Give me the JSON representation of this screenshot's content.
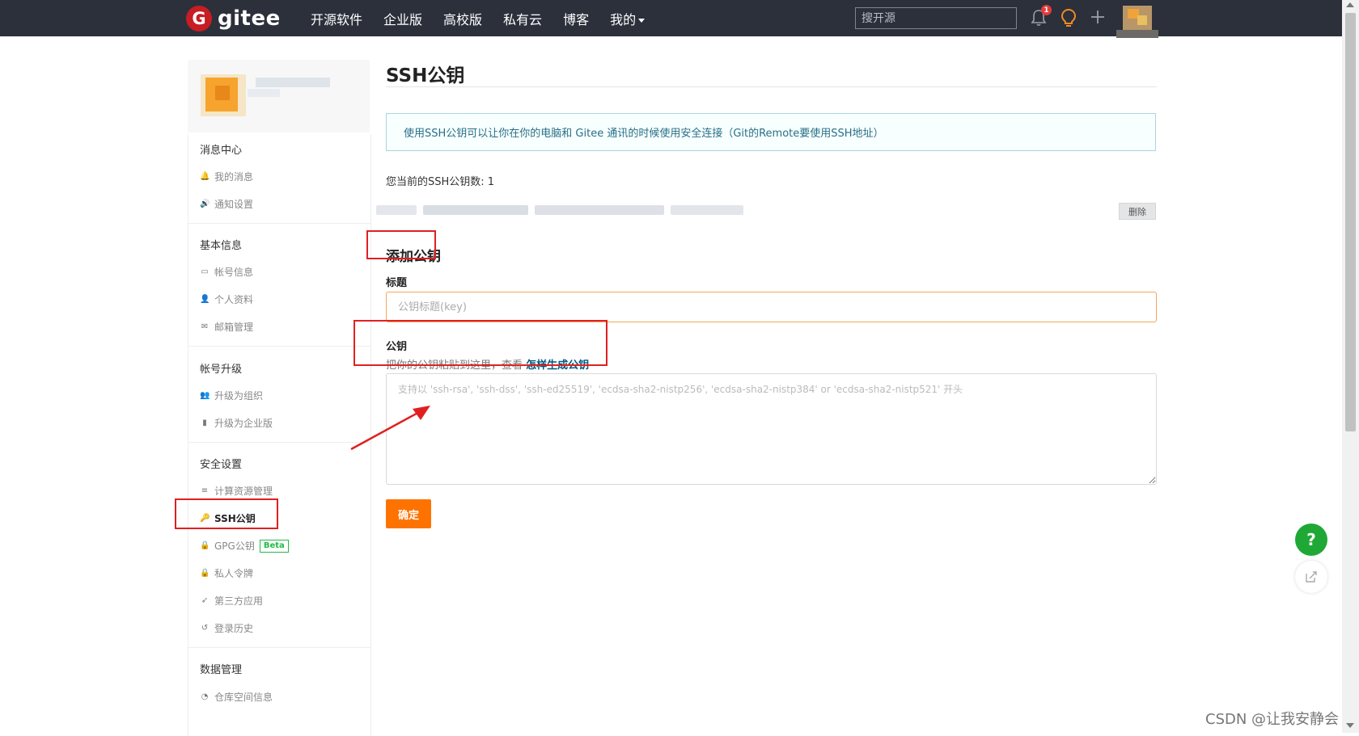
{
  "nav": {
    "logo_mark": "G",
    "logo_text": "gitee",
    "items": [
      "开源软件",
      "企业版",
      "高校版",
      "私有云",
      "博客",
      "我的"
    ],
    "search_placeholder": "搜开源",
    "notification_count": "1",
    "icons": [
      "bell-icon",
      "lightbulb-icon",
      "plus-icon"
    ]
  },
  "sidebar": {
    "groups": [
      {
        "title": "消息中心",
        "items": [
          {
            "icon": "bell-icon",
            "glyph": "🔔",
            "label": "我的消息"
          },
          {
            "icon": "speaker-icon",
            "glyph": "🔊",
            "label": "通知设置"
          }
        ]
      },
      {
        "title": "基本信息",
        "items": [
          {
            "icon": "id-card-icon",
            "glyph": "▭",
            "label": "帐号信息"
          },
          {
            "icon": "user-icon",
            "glyph": "👤",
            "label": "个人资料"
          },
          {
            "icon": "mail-icon",
            "glyph": "✉",
            "label": "邮箱管理"
          }
        ]
      },
      {
        "title": "帐号升级",
        "items": [
          {
            "icon": "group-icon",
            "glyph": "👥",
            "label": "升级为组织"
          },
          {
            "icon": "building-icon",
            "glyph": "▮",
            "label": "升级为企业版"
          }
        ]
      },
      {
        "title": "安全设置",
        "items": [
          {
            "icon": "list-icon",
            "glyph": "≡",
            "label": "计算资源管理"
          },
          {
            "icon": "key-icon",
            "glyph": "🔑",
            "label": "SSH公钥"
          },
          {
            "icon": "lock-icon",
            "glyph": "🔒",
            "label": "GPG公钥"
          },
          {
            "icon": "token-lock-icon",
            "glyph": "🔒",
            "label": "私人令牌"
          },
          {
            "icon": "rocket-icon",
            "glyph": "➶",
            "label": "第三方应用"
          },
          {
            "icon": "history-icon",
            "glyph": "↺",
            "label": "登录历史"
          }
        ]
      },
      {
        "title": "数据管理",
        "items": [
          {
            "icon": "pie-chart-icon",
            "glyph": "◔",
            "label": "仓库空间信息"
          }
        ]
      }
    ],
    "beta_badge": "Beta",
    "active_item": "SSH公钥"
  },
  "main": {
    "title": "SSH公钥",
    "info": "使用SSH公钥可以让你在你的电脑和 Gitee 通讯的时候使用安全连接（Git的Remote要使用SSH地址）",
    "key_count": "您当前的SSH公钥数: 1",
    "delete_label": "删除",
    "add_title": "添加公钥",
    "title_label": "标题",
    "title_placeholder": "公钥标题(key)",
    "key_label": "公钥",
    "key_help_prefix": "把你的公钥粘贴到这里，查看",
    "key_help_link": "怎样生成公钥",
    "key_placeholder": "支持以 'ssh-rsa', 'ssh-dss', 'ssh-ed25519', 'ecdsa-sha2-nistp256', 'ecdsa-sha2-nistp384' or 'ecdsa-sha2-nistp521' 开头",
    "confirm_label": "确定"
  },
  "float": {
    "help_label": "?",
    "feedback_icon": "edit-icon"
  },
  "watermark": "CSDN @让我安静会",
  "colors": {
    "nav_bg": "#2b303b",
    "brand_red": "#c71d23",
    "confirm_orange": "#fe7300",
    "annotation_red": "#e02020",
    "help_green": "#1fa835"
  }
}
